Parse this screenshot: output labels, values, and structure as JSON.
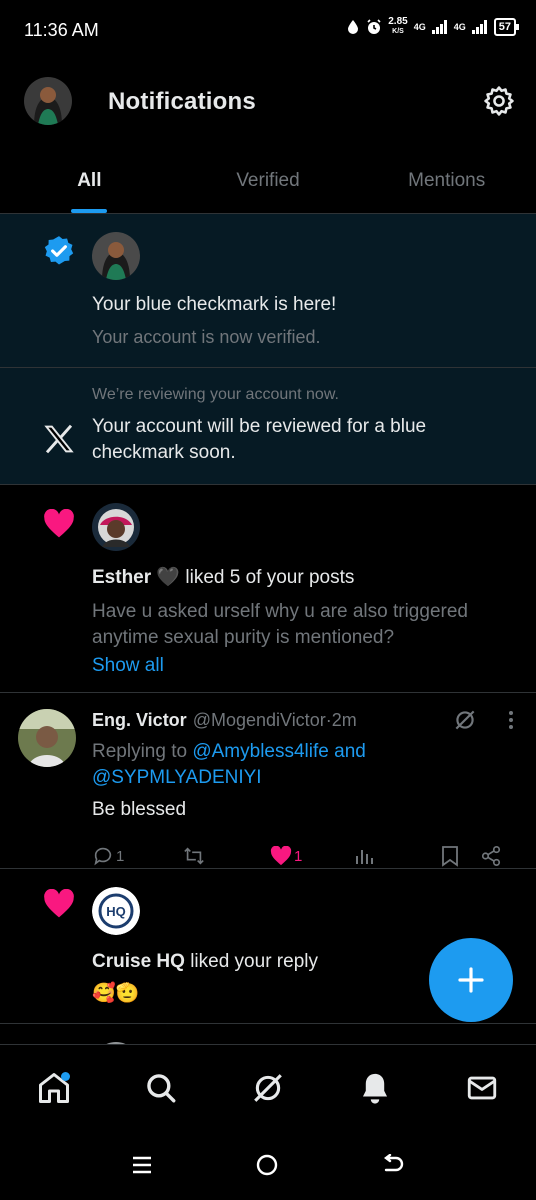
{
  "status": {
    "time": "11:36 AM",
    "net_speed": "2.85",
    "net_unit": "K/S",
    "net1": "4G",
    "net2": "4G",
    "battery": "57"
  },
  "header": {
    "title": "Notifications"
  },
  "tabs": [
    {
      "label": "All"
    },
    {
      "label": "Verified"
    },
    {
      "label": "Mentions"
    }
  ],
  "notifications": {
    "verified": {
      "title": "Your blue checkmark is here!",
      "subtitle": "Your account is now verified."
    },
    "review": {
      "small": "We’re reviewing your account now.",
      "text": "Your account will be reviewed for a blue checkmark soon."
    },
    "like1": {
      "name": "Esther",
      "heart": "🖤",
      "action": " liked 5 of your posts",
      "preview": "Have u asked urself why u are also triggered anytime sexual purity is mentioned?",
      "show_all": "Show all"
    },
    "post": {
      "name": "Eng. Victor",
      "handle": "@MogendiVictor",
      "dot": " · ",
      "time": "2m",
      "replying_prefix": "Replying to ",
      "replying_user1": "@Amybless4life",
      "replying_and": " and",
      "replying_user2": "@SYPMLYADENIYI",
      "text": "Be blessed",
      "reply_count": "1",
      "like_count": "1"
    },
    "like2": {
      "name": "Cruise HQ",
      "action": " liked your reply",
      "emojis": "🥰🫡"
    }
  },
  "colors": {
    "accent": "#1d9bf0",
    "like": "#f91880",
    "highlight_bg": "#061a24"
  }
}
